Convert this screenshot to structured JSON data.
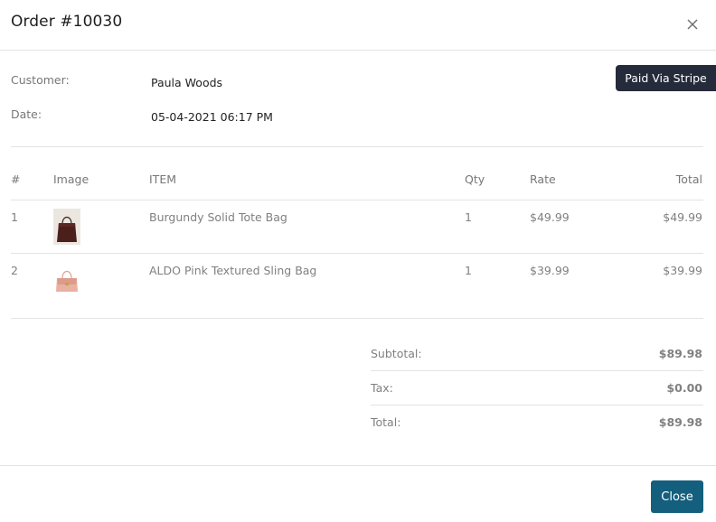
{
  "header": {
    "title": "Order #10030"
  },
  "badge": {
    "text": "Paid Via Stripe"
  },
  "order": {
    "customer_label": "Customer:",
    "customer_value": "Paula Woods",
    "date_label": "Date:",
    "date_value": "05-04-2021 06:17 PM"
  },
  "table": {
    "headers": [
      "#",
      "Image",
      "ITEM",
      "Qty",
      "Rate",
      "Total"
    ],
    "rows": [
      {
        "num": "1",
        "image": "brown-tote-bag",
        "item": "Burgundy Solid Tote Bag",
        "qty": "1",
        "rate": "$49.99",
        "total": "$49.99"
      },
      {
        "num": "2",
        "image": "pink-sling-bag",
        "item": "ALDO Pink Textured Sling Bag",
        "qty": "1",
        "rate": "$39.99",
        "total": "$39.99"
      }
    ]
  },
  "summary": {
    "subtotal_label": "Subtotal:",
    "subtotal_value": "$89.98",
    "tax_label": "Tax:",
    "tax_value": "$0.00",
    "total_label": "Total:",
    "total_value": "$89.98"
  },
  "footer": {
    "close_label": "Close"
  },
  "icons": {
    "close": "close-icon"
  },
  "colors": {
    "badge_bg": "#262b3b",
    "button_bg": "#145f7d"
  }
}
